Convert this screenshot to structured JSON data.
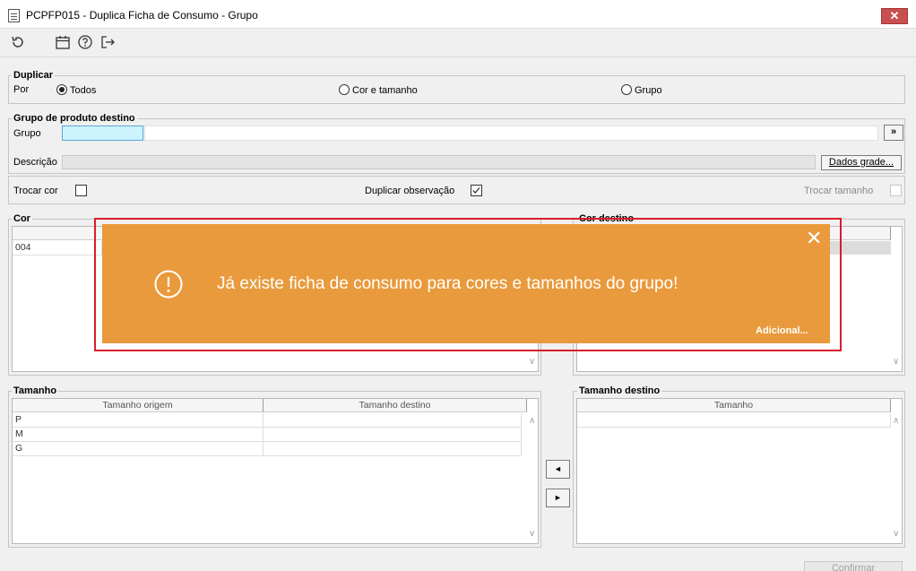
{
  "window": {
    "title": "PCPFP015 - Duplica Ficha de Consumo - Grupo",
    "close_glyph": "✕"
  },
  "toolbar": {
    "icons": [
      "refresh-icon",
      "calendar-icon",
      "help-icon",
      "exit-icon"
    ]
  },
  "duplicar": {
    "legend": "Duplicar",
    "por_label": "Por",
    "options": [
      {
        "label": "Todos",
        "selected": true
      },
      {
        "label": "Cor e tamanho",
        "selected": false
      },
      {
        "label": "Grupo",
        "selected": false
      }
    ]
  },
  "grupo_destino": {
    "legend": "Grupo de produto destino",
    "grupo_label": "Grupo",
    "grupo_value": "",
    "lookup_label": "»",
    "descricao_label": "Descrição",
    "descricao_value": "",
    "dados_grade_label": "Dados grade..."
  },
  "options_row": {
    "trocar_cor_label": "Trocar cor",
    "trocar_cor_checked": false,
    "duplicar_obs_label": "Duplicar observação",
    "duplicar_obs_checked": true,
    "trocar_tamanho_label": "Trocar tamanho",
    "trocar_tamanho_checked": false
  },
  "cor": {
    "legend": "Cor",
    "rows": [
      "004"
    ]
  },
  "cor_destino": {
    "legend": "Cor destino",
    "rows": [
      ""
    ]
  },
  "tamanho": {
    "legend": "Tamanho",
    "columns": [
      "Tamanho origem",
      "Tamanho destino"
    ],
    "rows": [
      [
        "P",
        ""
      ],
      [
        "M",
        ""
      ],
      [
        "G",
        ""
      ]
    ]
  },
  "tamanho_destino": {
    "legend": "Tamanho destino",
    "columns": [
      "Tamanho"
    ],
    "rows": [
      ""
    ]
  },
  "transfer": {
    "left_glyph": "◄",
    "right_glyph": "►"
  },
  "footer": {
    "confirm_label": "Confirmar"
  },
  "toast": {
    "message": "Já existe ficha de consumo para cores e tamanhos do grupo!",
    "more_label": "Adicional...",
    "close_glyph": "✕",
    "color": "#e99a3c",
    "border_color": "#d81e2a"
  }
}
